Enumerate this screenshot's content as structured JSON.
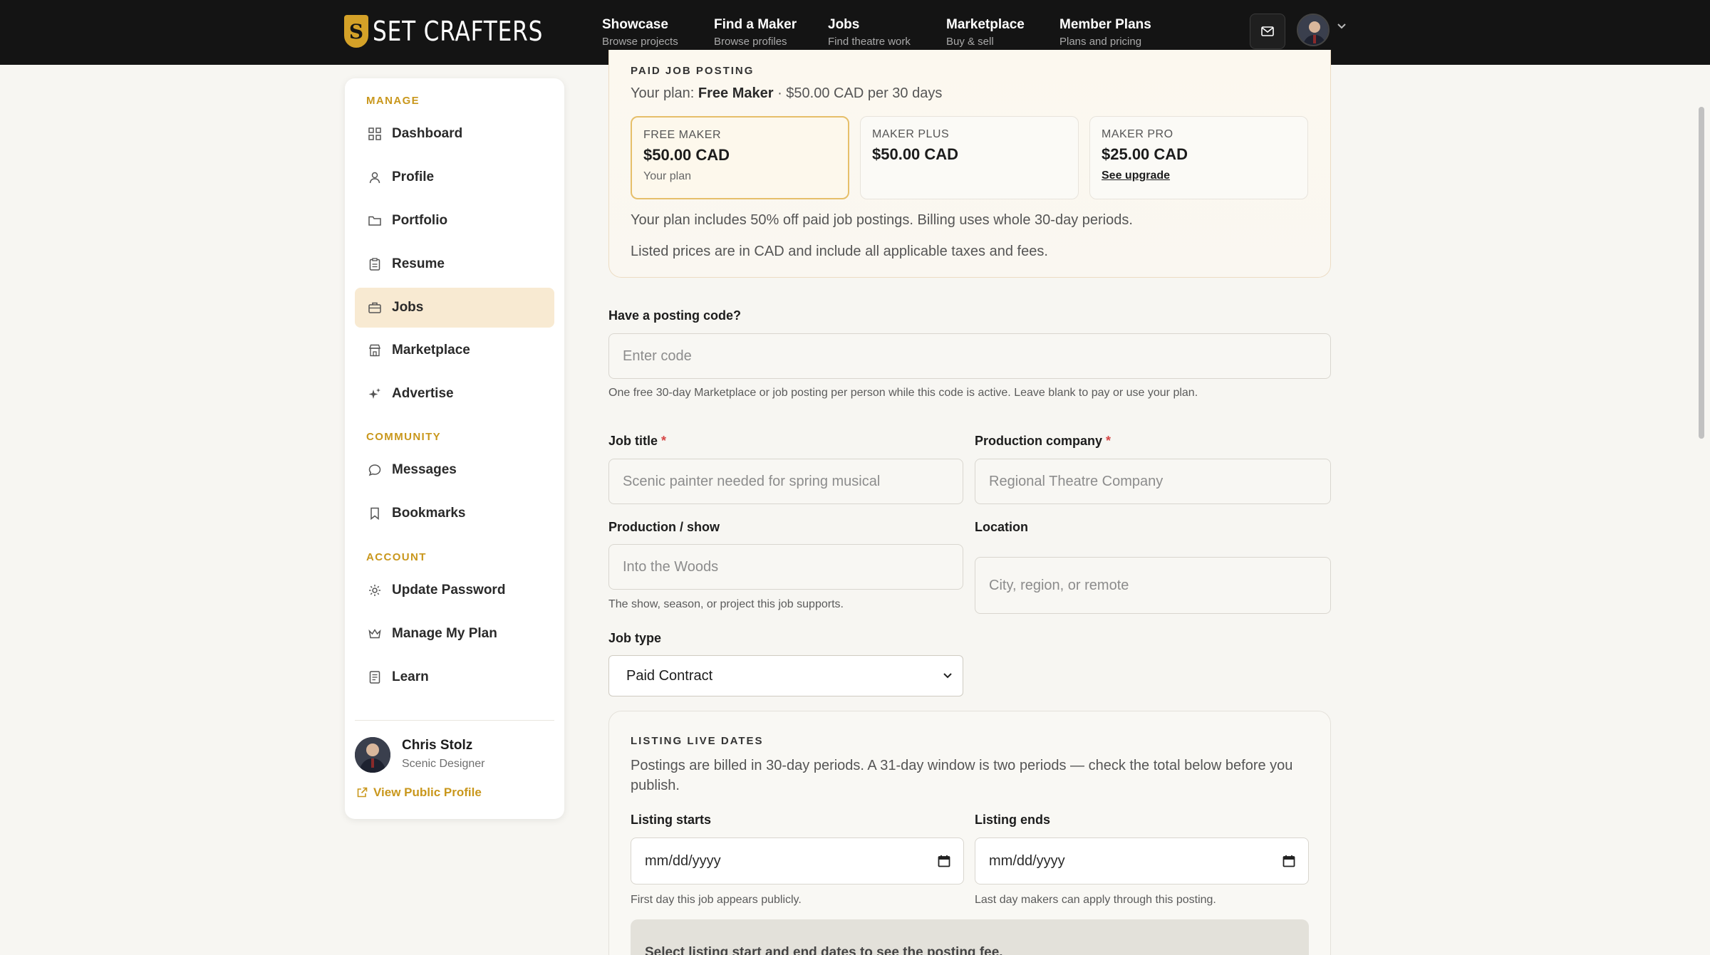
{
  "brand": {
    "name": "SET CRAFTERS",
    "mark": "S"
  },
  "nav": [
    {
      "title": "Showcase",
      "sub": "Browse projects"
    },
    {
      "title": "Find a Maker",
      "sub": "Browse profiles"
    },
    {
      "title": "Jobs",
      "sub": "Find theatre work"
    },
    {
      "title": "Marketplace",
      "sub": "Buy & sell"
    },
    {
      "title": "Member Plans",
      "sub": "Plans and pricing"
    }
  ],
  "sidebar": {
    "sections": {
      "manage": "MANAGE",
      "community": "COMMUNITY",
      "account": "ACCOUNT"
    },
    "items": [
      {
        "label": "Dashboard",
        "icon": "grid-icon"
      },
      {
        "label": "Profile",
        "icon": "user-icon"
      },
      {
        "label": "Portfolio",
        "icon": "folder-icon"
      },
      {
        "label": "Resume",
        "icon": "clipboard-icon"
      },
      {
        "label": "Jobs",
        "icon": "briefcase-icon",
        "active": true
      },
      {
        "label": "Marketplace",
        "icon": "store-icon"
      },
      {
        "label": "Advertise",
        "icon": "sparkle-icon"
      },
      {
        "label": "Messages",
        "icon": "chat-icon"
      },
      {
        "label": "Bookmarks",
        "icon": "bookmark-icon"
      },
      {
        "label": "Update Password",
        "icon": "gear-icon"
      },
      {
        "label": "Manage My Plan",
        "icon": "crown-icon"
      },
      {
        "label": "Learn",
        "icon": "document-icon"
      }
    ],
    "user": {
      "name": "Chris Stolz",
      "role": "Scenic Designer",
      "public_link": "View Public Profile"
    }
  },
  "plan": {
    "eyebrow": "PAID JOB POSTING",
    "line_prefix": "Your plan: ",
    "plan_name": "Free Maker",
    "line_suffix": " · $50.00 CAD per 30 days",
    "tiers": [
      {
        "name": "FREE MAKER",
        "price": "$50.00 CAD",
        "note": "Your plan",
        "current": true
      },
      {
        "name": "MAKER PLUS",
        "price": "$50.00 CAD",
        "note": ""
      },
      {
        "name": "MAKER PRO",
        "price": "$25.00 CAD",
        "link": "See upgrade"
      }
    ],
    "info1": "Your plan includes 50% off paid job postings. Billing uses whole 30-day periods.",
    "info2": "Listed prices are in CAD and include all applicable taxes and fees."
  },
  "form": {
    "code_label": "Have a posting code?",
    "code_placeholder": "Enter code",
    "code_help": "One free 30-day Marketplace or job posting per person while this code is active. Leave blank to pay or use your plan.",
    "job_title_label": "Job title",
    "job_title_placeholder": "Scenic painter needed for spring musical",
    "company_label": "Production company",
    "company_placeholder": "Regional Theatre Company",
    "show_label": "Production / show",
    "show_placeholder": "Into the Woods",
    "show_help": "The show, season, or project this job supports.",
    "location_label": "Location",
    "location_placeholder": "City, region, or remote",
    "job_type_label": "Job type",
    "job_type_value": "Paid Contract",
    "required_mark": "*"
  },
  "dates": {
    "eyebrow": "LISTING LIVE DATES",
    "desc": "Postings are billed in 30-day periods. A 31-day window is two periods — check the total below before you publish.",
    "start_label": "Listing starts",
    "start_value": "mm/dd/yyyy",
    "start_help": "First day this job appears publicly.",
    "end_label": "Listing ends",
    "end_value": "mm/dd/yyyy",
    "end_help": "Last day makers can apply through this posting.",
    "fee_text": "Select listing start and end dates to see the posting fee."
  }
}
